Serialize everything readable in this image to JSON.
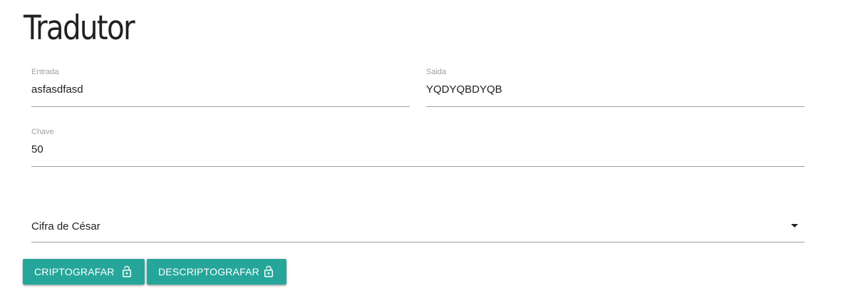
{
  "page": {
    "title": "Tradutor"
  },
  "fields": {
    "entrada": {
      "label": "Entrada",
      "value": "asfasdfasd"
    },
    "saida": {
      "label": "Saida",
      "value": "YQDYQBDYQB"
    },
    "chave": {
      "label": "Chave",
      "value": "50"
    }
  },
  "cipher_select": {
    "selected": "Cifra de César",
    "icon": "dropdown-arrow-icon"
  },
  "buttons": {
    "encrypt": {
      "label": "CRIPTOGRAFAR",
      "icon": "lock-open-icon"
    },
    "decrypt": {
      "label": "DESCRIPTOGRAFAR",
      "icon": "lock-open-icon"
    }
  },
  "colors": {
    "button_bg": "#26a69a",
    "text": "#212121",
    "label": "#9e9e9e",
    "underline": "#9e9e9e"
  }
}
